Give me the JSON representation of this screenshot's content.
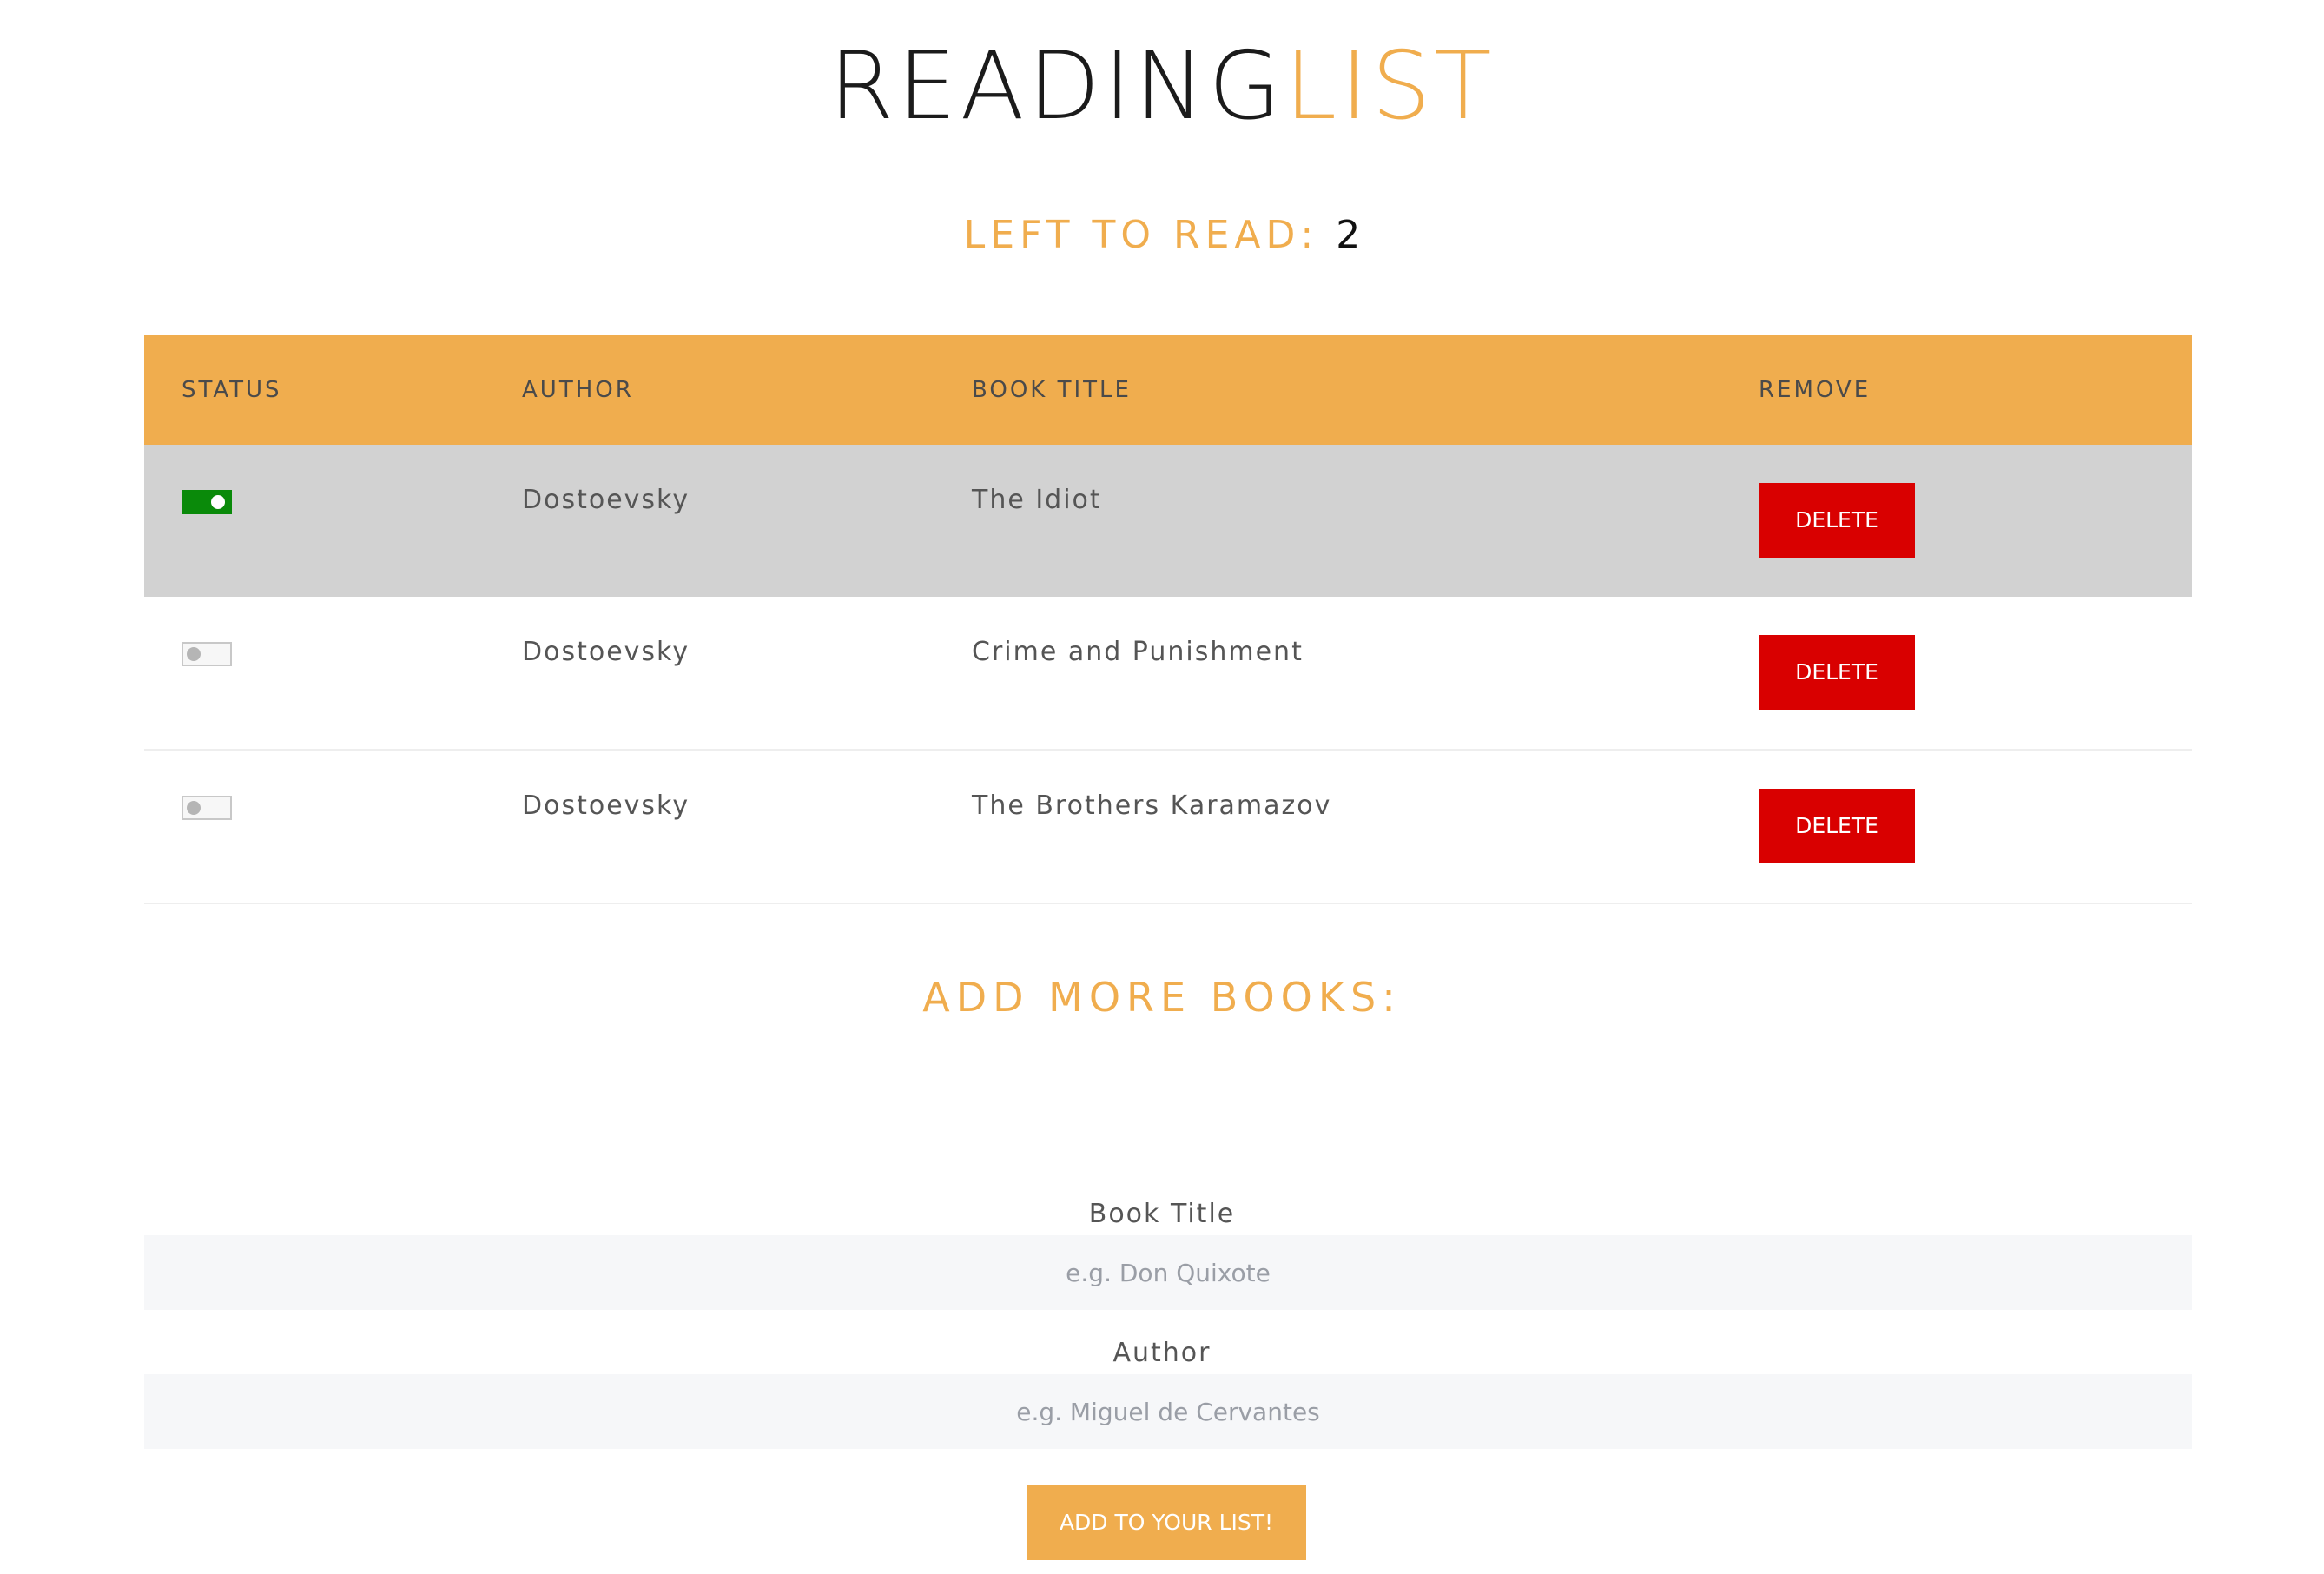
{
  "header": {
    "title_part1": "READING",
    "title_part2": "LIST"
  },
  "summary": {
    "left_to_read_label": "LEFT TO READ:",
    "left_to_read_count": "2"
  },
  "table": {
    "columns": [
      "STATUS",
      "AUTHOR",
      "BOOK TITLE",
      "REMOVE"
    ],
    "rows": [
      {
        "read": true,
        "author": "Dostoevsky",
        "title": "The Idiot",
        "action": "DELETE"
      },
      {
        "read": false,
        "author": "Dostoevsky",
        "title": "Crime and Punishment",
        "action": "DELETE"
      },
      {
        "read": false,
        "author": "Dostoevsky",
        "title": "The Brothers Karamazov",
        "action": "DELETE"
      }
    ]
  },
  "form": {
    "heading": "ADD MORE BOOKS:",
    "title_label": "Book Title",
    "title_placeholder": "e.g. Don Quixote",
    "author_label": "Author",
    "author_placeholder": "e.g. Miguel de Cervantes",
    "submit_label": "ADD TO YOUR LIST!"
  },
  "colors": {
    "accent": "#f0ad4e",
    "delete": "#d90000",
    "toggle_on": "#0a8a0a",
    "read_row": "#d2d2d2"
  }
}
